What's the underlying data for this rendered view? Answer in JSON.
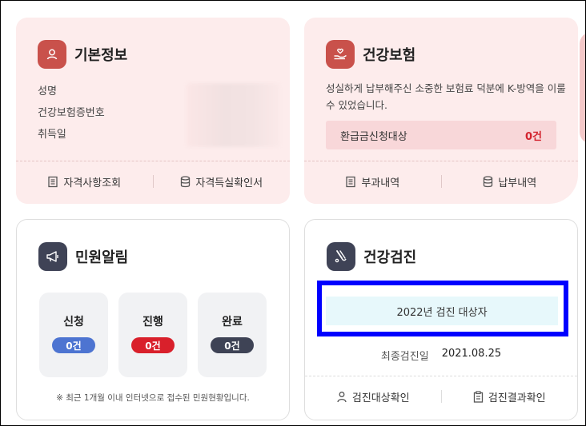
{
  "basic_info": {
    "title": "기본정보",
    "icon": "user-icon",
    "rows": [
      "성명",
      "건강보험증번호",
      "취득일"
    ],
    "links": [
      "자격사항조회",
      "자격득실확인서"
    ]
  },
  "insurance": {
    "title": "건강보험",
    "icon": "hand-heart-icon",
    "description": "성실하게 납부해주신 소중한 보험료 덕분에 K-방역을 이룰 수 있었습니다.",
    "refund_label": "환급금신청대상",
    "refund_count": "0건",
    "links": [
      "부과내역",
      "납부내역"
    ]
  },
  "civil": {
    "title": "민원알림",
    "icon": "megaphone-icon",
    "statuses": [
      {
        "label": "신청",
        "count": "0건"
      },
      {
        "label": "진행",
        "count": "0건"
      },
      {
        "label": "완료",
        "count": "0건"
      }
    ],
    "note": "※ 최근 1개월 이내 인터넷으로 접수된 민원현황입니다."
  },
  "checkup": {
    "title": "건강검진",
    "icon": "stethoscope-icon",
    "target_text": "2022년 검진 대상자",
    "last_exam_label": "최종검진일",
    "last_exam_date": "2021.08.25",
    "links": [
      "검진대상확인",
      "검진결과확인"
    ]
  },
  "colors": {
    "accent_red": "#c9514b",
    "pink_bg": "#fdecec",
    "highlight": "#0000ff",
    "pill_blue": "#4d74d1",
    "pill_red": "#d9202b",
    "pill_dark": "#3e4355"
  }
}
